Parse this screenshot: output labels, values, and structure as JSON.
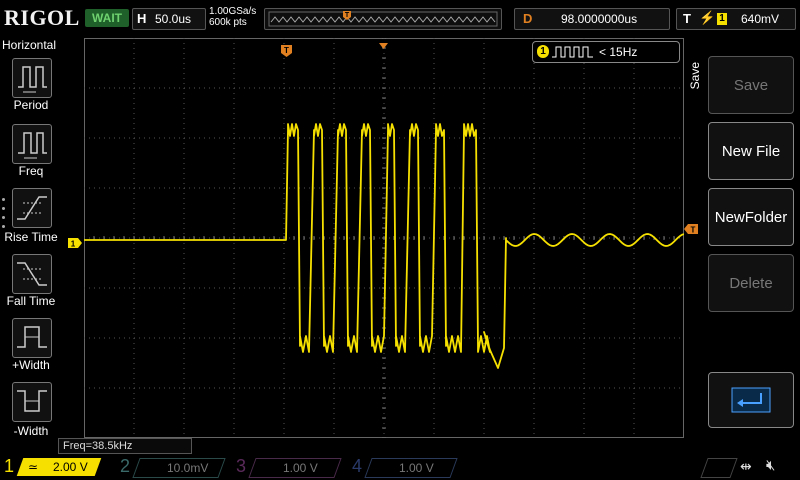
{
  "header": {
    "logo": "RIGOL",
    "run_status": "WAIT",
    "horizontal_key": "H",
    "timebase": "50.0us",
    "sample_rate": "1.00GSa/s",
    "memory_depth": "600k pts",
    "delay_key": "D",
    "delay_value": "98.0000000us",
    "trigger_key": "T",
    "trigger_source": "1",
    "trigger_level": "640mV"
  },
  "left_menu": {
    "title": "Horizontal",
    "items": [
      {
        "label": "Period",
        "icon": "period-icon"
      },
      {
        "label": "Freq",
        "icon": "freq-icon"
      },
      {
        "label": "Rise Time",
        "icon": "rise-time-icon"
      },
      {
        "label": "Fall Time",
        "icon": "fall-time-icon"
      },
      {
        "label": "+Width",
        "icon": "positive-width-icon"
      },
      {
        "label": "-Width",
        "icon": "negative-width-icon"
      }
    ]
  },
  "right_menu": {
    "side_label": "Save",
    "buttons": [
      {
        "label": "Save",
        "enabled": false
      },
      {
        "label": "New File",
        "enabled": true
      },
      {
        "label": "NewFolder",
        "enabled": true
      },
      {
        "label": "Delete",
        "enabled": false
      },
      {
        "label": "",
        "icon": "return-icon",
        "enabled": true
      }
    ]
  },
  "measurements": {
    "freq_readout": "Freq=38.5kHz",
    "frequency_counter_channel": "1",
    "frequency_counter_value": "< 15Hz"
  },
  "channels": [
    {
      "num": "1",
      "scale": "2.00 V",
      "color": "#f5e000",
      "active": true
    },
    {
      "num": "2",
      "scale": "10.0mV",
      "color": "#00c8d8",
      "active": false
    },
    {
      "num": "3",
      "scale": "1.00 V",
      "color": "#d020d0",
      "active": false
    },
    {
      "num": "4",
      "scale": "1.00 V",
      "color": "#2060ff",
      "active": false
    }
  ],
  "markers": {
    "channel_marker": "1",
    "trigger_marker": "T"
  },
  "colors": {
    "ch1": "#f5e000",
    "trigger": "#e08020",
    "grid": "#555555",
    "wait_bg": "#1f5f2a"
  }
}
